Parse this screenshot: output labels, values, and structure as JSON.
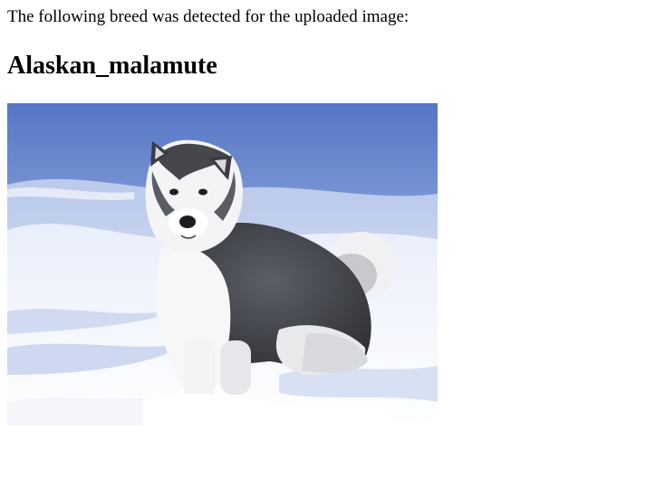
{
  "result": {
    "intro_text": "The following breed was detected for the uploaded image:",
    "breed_name": "Alaskan_malamute"
  },
  "image": {
    "subject": "alaskan-malamute-dog-in-snow"
  }
}
